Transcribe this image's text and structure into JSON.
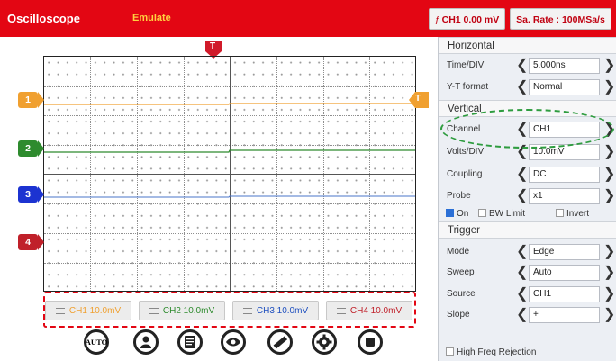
{
  "app": {
    "title": "Oscilloscope",
    "mode": "Emulate"
  },
  "header": {
    "ch_button": "CH1 0.00 mV",
    "ch_button_icon": "trigger-edge-icon",
    "rate_button": "Sa. Rate : 100MSa/s"
  },
  "markers": {
    "trigger_top": "T",
    "trigger_right": "T",
    "ch1": "1",
    "ch2": "2",
    "ch3": "3",
    "ch4": "4"
  },
  "channels": [
    {
      "label": "CH1 10.0mV",
      "color": "#f0a030"
    },
    {
      "label": "CH2 10.0mV",
      "color": "#2e8b2e"
    },
    {
      "label": "CH3 10.0mV",
      "color": "#1e4fbf"
    },
    {
      "label": "CH4 10.0mV",
      "color": "#c0202a"
    }
  ],
  "toolbar": {
    "auto": "AUTO",
    "icons": [
      "auto-icon",
      "person-icon",
      "document-icon",
      "eye-icon",
      "ruler-icon",
      "gear-icon",
      "stop-icon"
    ]
  },
  "panel": {
    "horizontal": {
      "title": "Horizontal",
      "rows": [
        {
          "label": "Time/DIV",
          "value": "5.000ns"
        },
        {
          "label": "Y-T format",
          "value": "Normal"
        }
      ]
    },
    "vertical": {
      "title": "Vertical",
      "rows": [
        {
          "label": "Channel",
          "value": "CH1"
        },
        {
          "label": "Volts/DIV",
          "value": "10.0mV"
        },
        {
          "label": "Coupling",
          "value": "DC"
        },
        {
          "label": "Probe",
          "value": "x1"
        }
      ],
      "options": {
        "on": "On",
        "bw_limit": "BW Limit",
        "invert": "Invert"
      },
      "on_checked": true,
      "bw_checked": false,
      "invert_checked": false
    },
    "trigger": {
      "title": "Trigger",
      "rows": [
        {
          "label": "Mode",
          "value": "Edge"
        },
        {
          "label": "Sweep",
          "value": "Auto"
        },
        {
          "label": "Source",
          "value": "CH1"
        },
        {
          "label": "Slope",
          "value": "+"
        }
      ],
      "hf_rejection": "High Freq Rejection"
    }
  },
  "colors": {
    "brand": "#e30613",
    "highlight": "#2e9c3f"
  }
}
